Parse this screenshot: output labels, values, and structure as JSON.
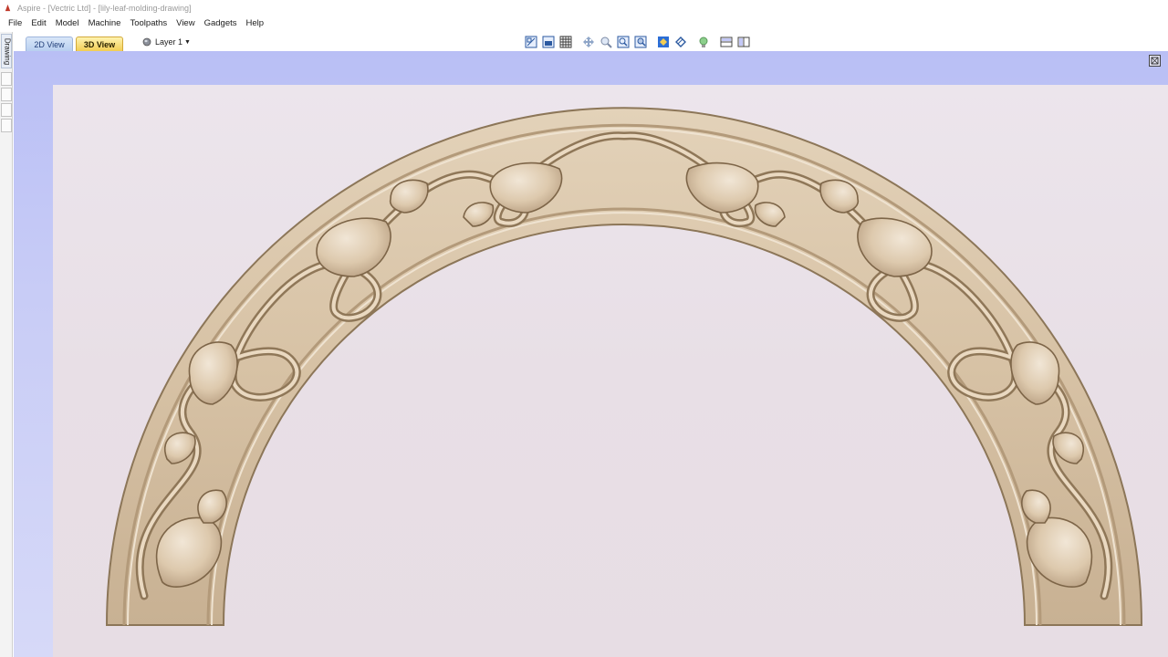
{
  "window": {
    "title": "Aspire - [Vectric Ltd] - [lily-leaf-molding-drawing]"
  },
  "menu": {
    "items": [
      "File",
      "Edit",
      "Model",
      "Machine",
      "Toolpaths",
      "View",
      "Gadgets",
      "Help"
    ]
  },
  "view_tabs": {
    "tab_2d": "2D View",
    "tab_3d": "3D View",
    "active": "3D View"
  },
  "layer": {
    "label": "Layer 1"
  },
  "left_panel": {
    "drawing_tab": "Drawing"
  },
  "toolbar_icons": [
    "zoom-extents-icon",
    "top-view-icon",
    "grid-icon",
    "pan-icon",
    "zoom-icon",
    "zoom-box-icon",
    "zoom-selection-icon",
    "render-mode-icon",
    "shading-icon",
    "lighting-icon",
    "split-horizontal-icon",
    "split-vertical-icon"
  ],
  "colors": {
    "viewport_bg": "#c3c8f6",
    "material": "#dcc8ad",
    "active_tab": "#f2cd54"
  }
}
